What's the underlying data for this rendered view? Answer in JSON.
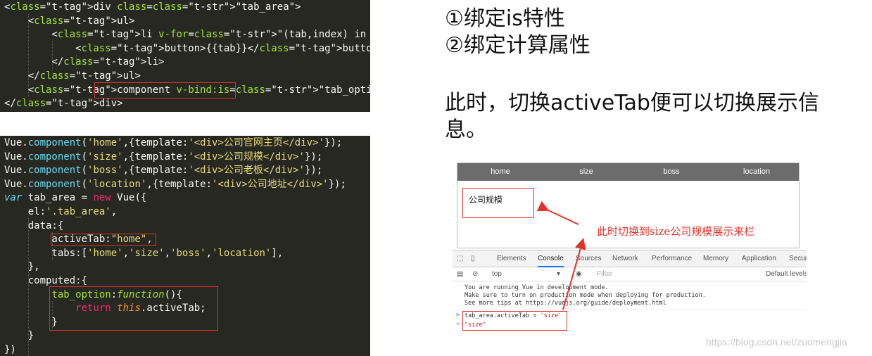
{
  "code_html": [
    "<div class=\"tab_area\">",
    "    <ul>",
    "        <li v-for=\"(tab,index) in tabs\" :key=\"tab.index\">",
    "            <button>{{tab}}</button>",
    "        </li>",
    "    </ul>",
    "    <component v-bind:is=\"tab_option\"></component>",
    "</div>"
  ],
  "code_js": [
    "Vue.component('home',{template:'<div>公司官网主页</div>'});",
    "Vue.component('size',{template:'<div>公司规模</div>'});",
    "Vue.component('boss',{template:'<div>公司老板</div>'});",
    "Vue.component('location',{template:'<div>公司地址</div>'});",
    "var tab_area = new Vue({",
    "    el:'.tab_area',",
    "    data:{",
    "        activeTab:\"home\",",
    "        tabs:['home','size','boss','location'],",
    "    },",
    "    computed:{",
    "        tab_option:function(){",
    "            return this.activeTab;",
    "        }",
    "    }",
    "})"
  ],
  "explanation": {
    "step1": "①绑定is特性",
    "step2": "②绑定计算属性",
    "note_line1": "此时，切换activeTab便可以切换展示信",
    "note_line2": "息。"
  },
  "demo": {
    "tabs": [
      "home",
      "size",
      "boss",
      "location"
    ],
    "content": "公司规模",
    "annotation": "此时切换到size公司规模展示来栏"
  },
  "devtools": {
    "tabs": [
      "Elements",
      "Console",
      "Sources",
      "Network",
      "Performance",
      "Memory",
      "Application",
      "Secur"
    ],
    "active_tab": "Console",
    "context": "top",
    "filter_placeholder": "Filter",
    "levels": "Default levels",
    "messages": [
      "You are running Vue in development mode.",
      "Make sure to turn on production mode when deploying for production.",
      "See more tips at https://vuejs.org/guide/deployment.html"
    ],
    "input_cmd": "tab_area.activeTab = ",
    "input_val": "'size'",
    "result": "\"size\""
  },
  "watermark": "https://blog.csdn.net/zuomengjia",
  "colors": {
    "editor_bg": "#272822",
    "highlight": "#e0332a",
    "tabbar": "#6c6c6c"
  }
}
